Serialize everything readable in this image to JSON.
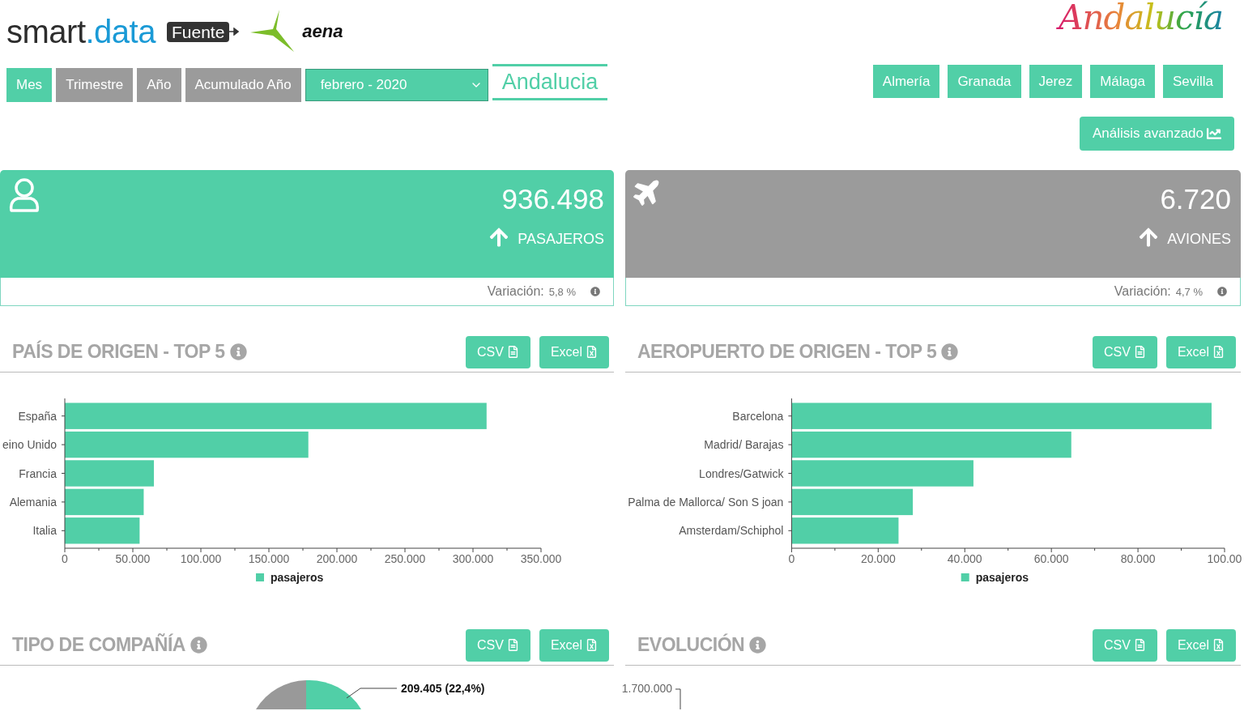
{
  "header": {
    "brand": [
      "smart",
      ".data"
    ],
    "source_badge": "Fuente",
    "source_logo": "aena",
    "region_logo": "Andalucía"
  },
  "period_tabs": [
    {
      "label": "Mes",
      "selected": true
    },
    {
      "label": "Trimestre",
      "selected": false
    },
    {
      "label": "Año",
      "selected": false
    },
    {
      "label": "Acumulado Año",
      "selected": false
    }
  ],
  "date_select": {
    "value": "febrero - 2020"
  },
  "region_title": "Andalucia",
  "airport_buttons": [
    "Almería",
    "Granada",
    "Jerez",
    "Málaga",
    "Sevilla"
  ],
  "advanced_button": "Análisis avanzado",
  "kpis": [
    {
      "kind": "passengers",
      "color": "#51cfa7",
      "value": "936.498",
      "label": "PASAJEROS",
      "variation_label": "Variación:",
      "variation": "5,8 %"
    },
    {
      "kind": "planes",
      "color": "#9b9b9b",
      "value": "6.720",
      "label": "AVIONES",
      "variation_label": "Variación:",
      "variation": "4,7 %"
    }
  ],
  "sections": [
    {
      "kind": "bar",
      "title": "PAÍS DE ORIGEN - TOP 5",
      "buttons": [
        "CSV",
        "Excel"
      ],
      "chart_data": {
        "type": "bar",
        "orientation": "horizontal",
        "categories": [
          "España",
          "eino Unido",
          "Francia",
          "Alemania",
          "Italia"
        ],
        "series": [
          {
            "name": "pasajeros",
            "color": "#51cfa7",
            "values": [
              310000,
              179000,
              65500,
              58000,
              55000
            ]
          }
        ],
        "xlim": [
          0,
          350000
        ],
        "xticks": [
          {
            "value": 0,
            "label": "0"
          },
          {
            "value": 50000,
            "label": "50.000"
          },
          {
            "value": 100000,
            "label": "100.000"
          },
          {
            "value": 150000,
            "label": "150.000"
          },
          {
            "value": 200000,
            "label": "200.000"
          },
          {
            "value": 250000,
            "label": "250.000"
          },
          {
            "value": 300000,
            "label": "300.000"
          },
          {
            "value": 350000,
            "label": "350.000"
          }
        ]
      }
    },
    {
      "kind": "bar",
      "title": "AEROPUERTO DE ORIGEN - TOP 5",
      "buttons": [
        "CSV",
        "Excel"
      ],
      "chart_data": {
        "type": "bar",
        "orientation": "horizontal",
        "categories": [
          "Barcelona",
          "Madrid/ Barajas",
          "Londres/Gatwick",
          "Palma de Mallorca/ Son S joan",
          "Amsterdam/Schiphol"
        ],
        "series": [
          {
            "name": "pasajeros",
            "color": "#51cfa7",
            "values": [
              97000,
              64600,
              42000,
              28000,
              24700
            ]
          }
        ],
        "xlim": [
          0,
          100000
        ],
        "xticks": [
          {
            "value": 0,
            "label": "0"
          },
          {
            "value": 20000,
            "label": "20.000"
          },
          {
            "value": 40000,
            "label": "40.000"
          },
          {
            "value": 60000,
            "label": "60.000"
          },
          {
            "value": 80000,
            "label": "80.000"
          }
        ]
      },
      "cut_tick_label": "100.00"
    },
    {
      "kind": "pie",
      "title": "TIPO DE COMPAÑÍA",
      "buttons": [
        "CSV",
        "Excel"
      ],
      "slice_label": "209.405 (22,4%)"
    },
    {
      "kind": "line",
      "title": "EVOLUCIÓN",
      "buttons": [
        "CSV",
        "Excel"
      ],
      "axis_label": "1.700.000"
    }
  ]
}
